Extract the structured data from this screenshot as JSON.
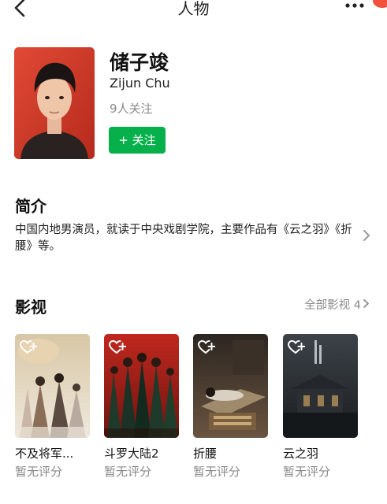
{
  "nav": {
    "title": "人物"
  },
  "profile": {
    "name": "储子竣",
    "english_name": "Zijun Chu",
    "followers": "9人关注",
    "follow_button": "+ 关注"
  },
  "intro": {
    "heading": "简介",
    "text": "中国内地男演员，就读于中央戏剧学院，主要作品有《云之羽》《折腰》等。"
  },
  "works": {
    "heading": "影视",
    "all_label": "全部影视 4",
    "items": [
      {
        "title": "不及将军...",
        "rating": "暂无评分"
      },
      {
        "title": "斗罗大陆2",
        "rating": "暂无评分"
      },
      {
        "title": "折腰",
        "rating": "暂无评分"
      },
      {
        "title": "云之羽",
        "rating": "暂无评分"
      }
    ]
  },
  "colors": {
    "accent_green": "#06b14b",
    "notification_red": "#f0523d",
    "muted_text": "#8a8a8a"
  },
  "icons": [
    "back-arrow-icon",
    "more-dots-icon",
    "chevron-right-icon",
    "heart-plus-icon"
  ]
}
